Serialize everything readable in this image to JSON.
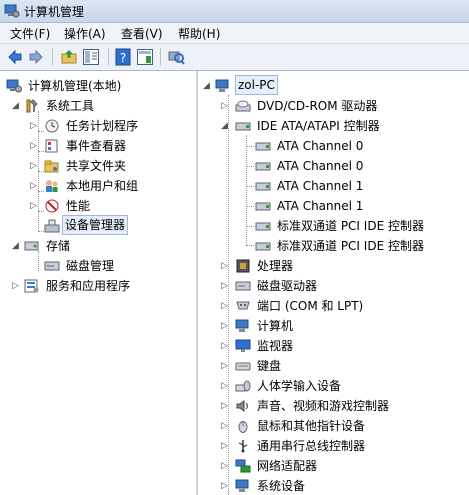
{
  "window": {
    "title": "计算机管理"
  },
  "menu": [
    "文件(F)",
    "操作(A)",
    "查看(V)",
    "帮助(H)"
  ],
  "toolbar": [
    "back-icon",
    "forward-icon",
    "up-folder-icon",
    "show-tree-icon",
    "help-icon",
    "properties-icon",
    "scan-hardware-icon"
  ],
  "left_tree": [
    {
      "label": "计算机管理(本地)",
      "icon": "computer-management-icon",
      "expander": "open"
    },
    {
      "label": "系统工具",
      "icon": "tools-icon",
      "expander": "open"
    },
    {
      "label": "任务计划程序",
      "icon": "clock-icon",
      "expander": "closed"
    },
    {
      "label": "事件查看器",
      "icon": "event-viewer-icon",
      "expander": "closed"
    },
    {
      "label": "共享文件夹",
      "icon": "shared-folder-icon",
      "expander": "closed"
    },
    {
      "label": "本地用户和组",
      "icon": "users-icon",
      "expander": "closed"
    },
    {
      "label": "性能",
      "icon": "performance-icon",
      "expander": "closed"
    },
    {
      "label": "设备管理器",
      "icon": "device-manager-icon",
      "expander": "none",
      "selected": true
    },
    {
      "label": "存储",
      "icon": "storage-icon",
      "expander": "open"
    },
    {
      "label": "磁盘管理",
      "icon": "disk-icon",
      "expander": "none"
    },
    {
      "label": "服务和应用程序",
      "icon": "services-icon",
      "expander": "closed"
    }
  ],
  "right_tree": [
    {
      "label": "zol-PC",
      "icon": "computer-icon",
      "expander": "open"
    },
    {
      "label": "DVD/CD-ROM 驱动器",
      "icon": "dvd-drive-icon",
      "expander": "closed"
    },
    {
      "label": "IDE ATA/ATAPI 控制器",
      "icon": "ide-controller-icon",
      "expander": "open"
    },
    {
      "label": "ATA Channel 0",
      "icon": "ide-channel-icon",
      "expander": "none"
    },
    {
      "label": "ATA Channel 0",
      "icon": "ide-channel-icon",
      "expander": "none"
    },
    {
      "label": "ATA Channel 1",
      "icon": "ide-channel-icon",
      "expander": "none"
    },
    {
      "label": "ATA Channel 1",
      "icon": "ide-channel-icon",
      "expander": "none"
    },
    {
      "label": "标准双通道 PCI IDE 控制器",
      "icon": "ide-channel-icon",
      "expander": "none"
    },
    {
      "label": "标准双通道 PCI IDE 控制器",
      "icon": "ide-channel-icon",
      "expander": "none"
    },
    {
      "label": "处理器",
      "icon": "processor-icon",
      "expander": "closed"
    },
    {
      "label": "磁盘驱动器",
      "icon": "disk-drive-icon",
      "expander": "closed"
    },
    {
      "label": "端口 (COM 和 LPT)",
      "icon": "port-icon",
      "expander": "closed"
    },
    {
      "label": "计算机",
      "icon": "computer-icon",
      "expander": "closed"
    },
    {
      "label": "监视器",
      "icon": "monitor-icon",
      "expander": "closed"
    },
    {
      "label": "键盘",
      "icon": "keyboard-icon",
      "expander": "closed"
    },
    {
      "label": "人体学输入设备",
      "icon": "hid-icon",
      "expander": "closed"
    },
    {
      "label": "声音、视频和游戏控制器",
      "icon": "sound-icon",
      "expander": "closed"
    },
    {
      "label": "鼠标和其他指针设备",
      "icon": "mouse-icon",
      "expander": "closed"
    },
    {
      "label": "通用串行总线控制器",
      "icon": "usb-icon",
      "expander": "closed"
    },
    {
      "label": "网络适配器",
      "icon": "network-adapter-icon",
      "expander": "closed"
    },
    {
      "label": "系统设备",
      "icon": "system-devices-icon",
      "expander": "closed"
    }
  ]
}
